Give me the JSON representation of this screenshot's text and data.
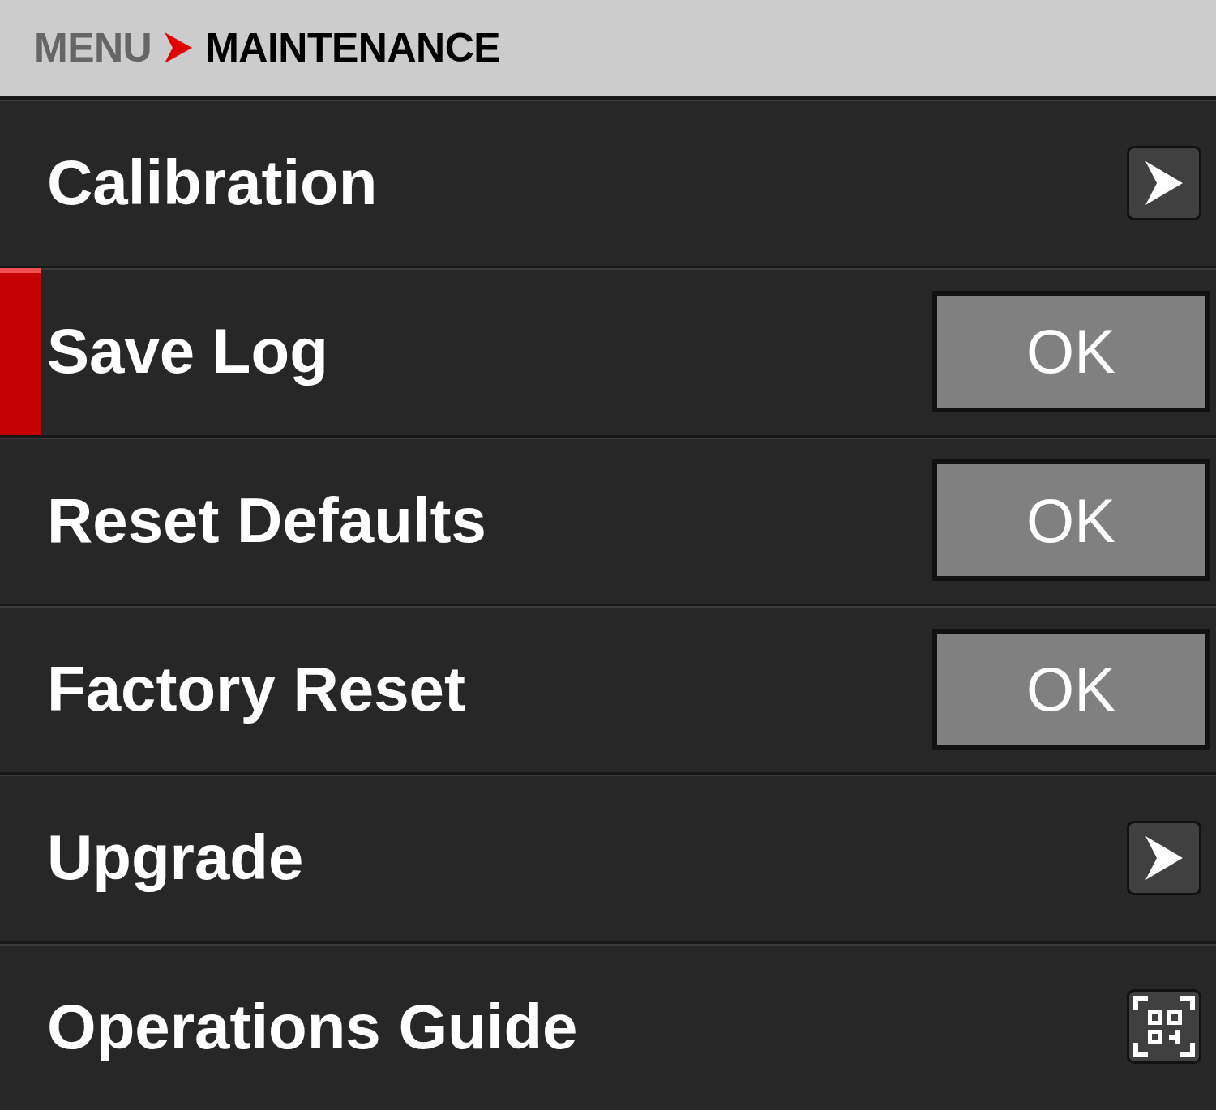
{
  "breadcrumb": {
    "parent": "MENU",
    "current": "MAINTENANCE"
  },
  "items": [
    {
      "label": "Calibration",
      "kind": "submenu",
      "selected": false
    },
    {
      "label": "Save Log",
      "kind": "action",
      "button": "OK",
      "selected": true
    },
    {
      "label": "Reset Defaults",
      "kind": "action",
      "button": "OK",
      "selected": false
    },
    {
      "label": "Factory Reset",
      "kind": "action",
      "button": "OK",
      "selected": false
    },
    {
      "label": "Upgrade",
      "kind": "submenu",
      "selected": false
    },
    {
      "label": "Operations Guide",
      "kind": "qr",
      "selected": false
    }
  ]
}
